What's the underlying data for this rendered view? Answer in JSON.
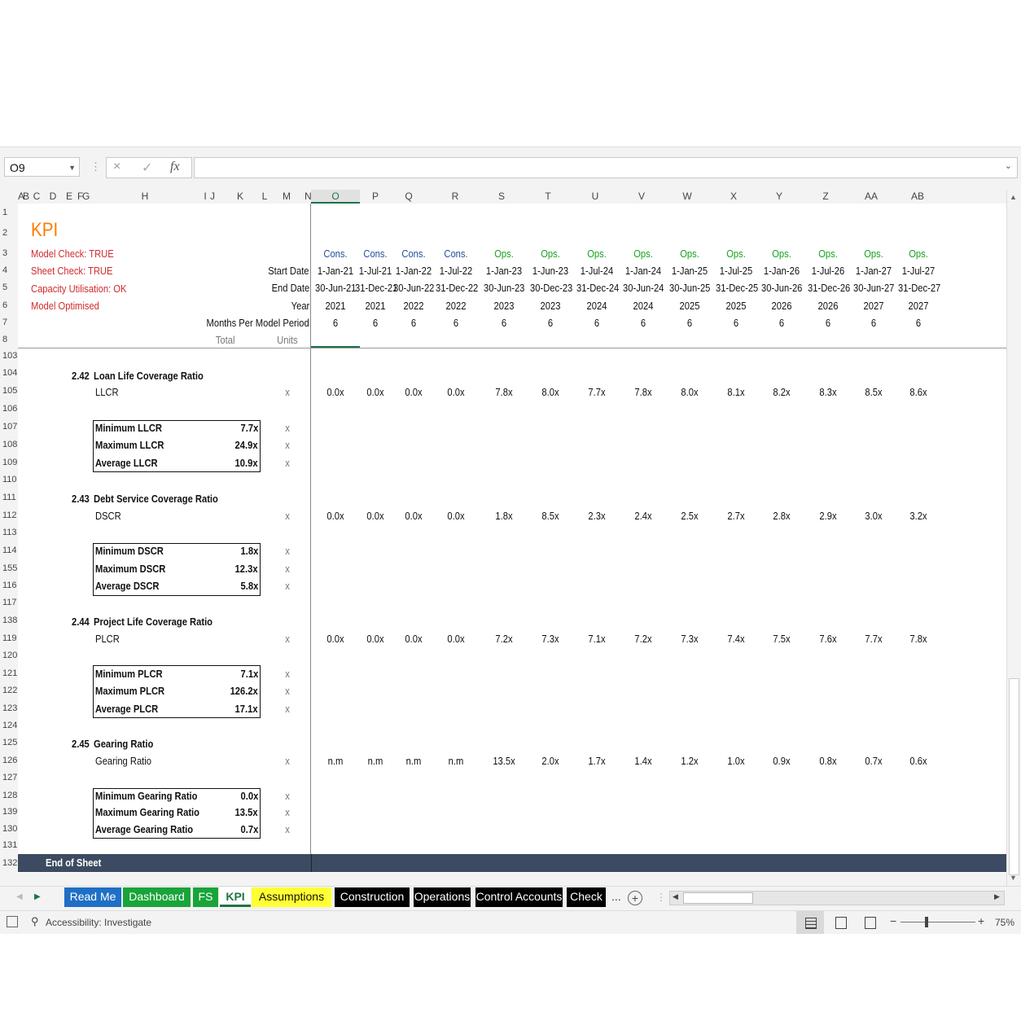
{
  "formula_bar": {
    "name_box": "O9",
    "cancel_icon": "×",
    "enter_icon": "✓",
    "fx_label": "fx"
  },
  "columns": [
    "A",
    "B",
    "C",
    "D",
    "E",
    "F",
    "G",
    "H",
    "I",
    "J",
    "K",
    "L",
    "M",
    "N",
    "O",
    "P",
    "Q",
    "R",
    "S",
    "T",
    "U",
    "V",
    "W",
    "X",
    "Y",
    "Z",
    "AA",
    "AB"
  ],
  "rows": [
    "1",
    "2",
    "3",
    "4",
    "5",
    "6",
    "7",
    "8",
    "103",
    "104",
    "105",
    "106",
    "107",
    "108",
    "109",
    "110",
    "111",
    "112",
    "113",
    "114",
    "155",
    "116",
    "117",
    "138",
    "119",
    "120",
    "121",
    "122",
    "123",
    "124",
    "125",
    "126",
    "127",
    "128",
    "139",
    "130",
    "131",
    "132"
  ],
  "title": "KPI",
  "checks": [
    "Model Check: TRUE",
    "Sheet Check: TRUE",
    "Capacity Utilisation: OK",
    "Model Optimised"
  ],
  "header_labels": {
    "start_date": "Start Date",
    "end_date": "End Date",
    "year": "Year",
    "months": "Months Per Model Period",
    "total": "Total",
    "units": "Units"
  },
  "periods": [
    {
      "phase": "Cons.",
      "start": "1-Jan-21",
      "end": "30-Jun-21",
      "year": "2021",
      "months": "6"
    },
    {
      "phase": "Cons.",
      "start": "1-Jul-21",
      "end": "31-Dec-21",
      "year": "2021",
      "months": "6"
    },
    {
      "phase": "Cons.",
      "start": "1-Jan-22",
      "end": "30-Jun-22",
      "year": "2022",
      "months": "6"
    },
    {
      "phase": "Cons.",
      "start": "1-Jul-22",
      "end": "31-Dec-22",
      "year": "2022",
      "months": "6"
    },
    {
      "phase": "Ops.",
      "start": "1-Jan-23",
      "end": "30-Jun-23",
      "year": "2023",
      "months": "6"
    },
    {
      "phase": "Ops.",
      "start": "1-Jun-23",
      "end": "30-Dec-23",
      "year": "2023",
      "months": "6"
    },
    {
      "phase": "Ops.",
      "start": "1-Jul-24",
      "end": "31-Dec-24",
      "year": "2024",
      "months": "6"
    },
    {
      "phase": "Ops.",
      "start": "1-Jan-24",
      "end": "30-Jun-24",
      "year": "2024",
      "months": "6"
    },
    {
      "phase": "Ops.",
      "start": "1-Jan-25",
      "end": "30-Jun-25",
      "year": "2025",
      "months": "6"
    },
    {
      "phase": "Ops.",
      "start": "1-Jul-25",
      "end": "31-Dec-25",
      "year": "2025",
      "months": "6"
    },
    {
      "phase": "Ops.",
      "start": "1-Jan-26",
      "end": "30-Jun-26",
      "year": "2026",
      "months": "6"
    },
    {
      "phase": "Ops.",
      "start": "1-Jul-26",
      "end": "31-Dec-26",
      "year": "2026",
      "months": "6"
    },
    {
      "phase": "Ops.",
      "start": "1-Jan-27",
      "end": "30-Jun-27",
      "year": "2027",
      "months": "6"
    },
    {
      "phase": "Ops.",
      "start": "1-Jul-27",
      "end": "31-Dec-27",
      "year": "2027",
      "months": "6"
    }
  ],
  "sections": [
    {
      "num": "2.42",
      "title": "Loan Life Coverage Ratio",
      "metric": "LLCR",
      "unit": "x",
      "values": [
        "0.0x",
        "0.0x",
        "0.0x",
        "0.0x",
        "7.8x",
        "8.0x",
        "7.7x",
        "7.8x",
        "8.0x",
        "8.1x",
        "8.2x",
        "8.3x",
        "8.5x",
        "8.6x"
      ],
      "stats": [
        {
          "label": "Minimum LLCR",
          "value": "7.7x"
        },
        {
          "label": "Maximum LLCR",
          "value": "24.9x"
        },
        {
          "label": "Average LLCR",
          "value": "10.9x"
        }
      ]
    },
    {
      "num": "2.43",
      "title": "Debt Service Coverage Ratio",
      "metric": "DSCR",
      "unit": "x",
      "values": [
        "0.0x",
        "0.0x",
        "0.0x",
        "0.0x",
        "1.8x",
        "8.5x",
        "2.3x",
        "2.4x",
        "2.5x",
        "2.7x",
        "2.8x",
        "2.9x",
        "3.0x",
        "3.2x"
      ],
      "stats": [
        {
          "label": "Minimum DSCR",
          "value": "1.8x"
        },
        {
          "label": "Maximum DSCR",
          "value": "12.3x"
        },
        {
          "label": "Average DSCR",
          "value": "5.8x"
        }
      ]
    },
    {
      "num": "2.44",
      "title": "Project Life Coverage Ratio",
      "metric": "PLCR",
      "unit": "x",
      "values": [
        "0.0x",
        "0.0x",
        "0.0x",
        "0.0x",
        "7.2x",
        "7.3x",
        "7.1x",
        "7.2x",
        "7.3x",
        "7.4x",
        "7.5x",
        "7.6x",
        "7.7x",
        "7.8x"
      ],
      "stats": [
        {
          "label": "Minimum PLCR",
          "value": "7.1x"
        },
        {
          "label": "Maximum PLCR",
          "value": "126.2x"
        },
        {
          "label": "Average PLCR",
          "value": "17.1x"
        }
      ]
    },
    {
      "num": "2.45",
      "title": "Gearing Ratio",
      "metric": "Gearing Ratio",
      "unit": "x",
      "values": [
        "n.m",
        "n.m",
        "n.m",
        "n.m",
        "13.5x",
        "2.0x",
        "1.7x",
        "1.4x",
        "1.2x",
        "1.0x",
        "0.9x",
        "0.8x",
        "0.7x",
        "0.6x"
      ],
      "stats": [
        {
          "label": "Minimum Gearing Ratio",
          "value": "0.0x"
        },
        {
          "label": "Maximum Gearing Ratio",
          "value": "13.5x"
        },
        {
          "label": "Average Gearing Ratio",
          "value": "0.7x"
        }
      ]
    }
  ],
  "end_of_sheet": "End of Sheet",
  "tabs": [
    {
      "label": "Read Me",
      "bg": "#1f6fc5",
      "fg": "#ffffff"
    },
    {
      "label": "Dashboard",
      "bg": "#19a43a",
      "fg": "#ffffff"
    },
    {
      "label": "FS",
      "bg": "#19a43a",
      "fg": "#ffffff"
    },
    {
      "label": "KPI",
      "bg": "#ffffff",
      "fg": "#217346",
      "active": true
    },
    {
      "label": "Assumptions",
      "bg": "#ffff33",
      "fg": "#111111"
    },
    {
      "label": "Construction",
      "bg": "#000000",
      "fg": "#ffffff"
    },
    {
      "label": "Operations",
      "bg": "#000000",
      "fg": "#ffffff"
    },
    {
      "label": "Control Accounts",
      "bg": "#000000",
      "fg": "#ffffff"
    },
    {
      "label": "Check",
      "bg": "#000000",
      "fg": "#ffffff"
    }
  ],
  "tab_more": "...",
  "status_bar": {
    "accessibility": "Accessibility: Investigate",
    "zoom": "75%"
  },
  "colors": {
    "check_red": "#d22b2b",
    "title_orange": "#ff7a00",
    "cons_blue": "#1f4e9e",
    "ops_green": "#15a21f",
    "end_bar": "#3c4b61"
  }
}
